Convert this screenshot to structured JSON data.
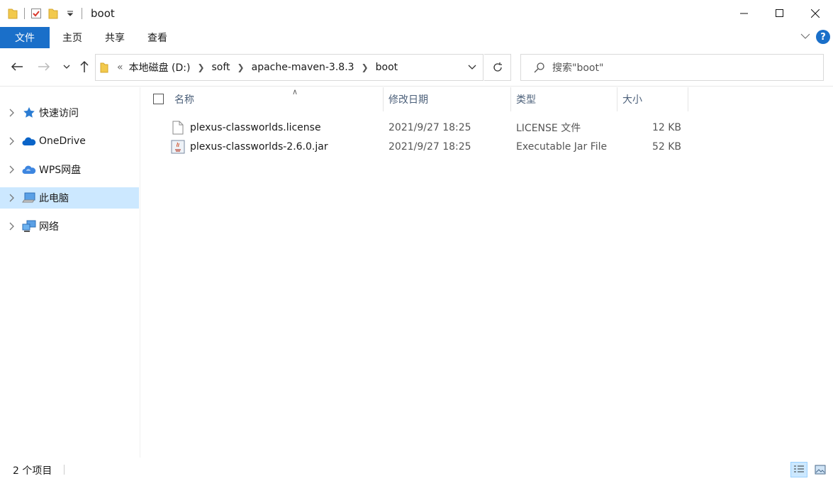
{
  "window": {
    "title": "boot",
    "controls": {
      "minimize": "minimize-icon",
      "maximize": "maximize-icon",
      "close": "close-icon"
    }
  },
  "ribbon": {
    "tabs": [
      {
        "label": "文件",
        "active": true
      },
      {
        "label": "主页"
      },
      {
        "label": "共享"
      },
      {
        "label": "查看"
      }
    ]
  },
  "address": {
    "overflow": "«",
    "crumbs": [
      "本地磁盘 (D:)",
      "soft",
      "apache-maven-3.8.3",
      "boot"
    ]
  },
  "search": {
    "placeholder": "搜索\"boot\""
  },
  "sidebar": {
    "items": [
      {
        "label": "快速访问",
        "icon": "star-icon"
      },
      {
        "label": "OneDrive",
        "icon": "cloud-icon"
      },
      {
        "label": "WPS网盘",
        "icon": "wps-cloud-icon"
      },
      {
        "label": "此电脑",
        "icon": "computer-icon",
        "selected": true
      },
      {
        "label": "网络",
        "icon": "network-icon"
      }
    ]
  },
  "table": {
    "headers": {
      "name": "名称",
      "modified": "修改日期",
      "type": "类型",
      "size": "大小"
    },
    "rows": [
      {
        "name": "plexus-classworlds.license",
        "modified": "2021/9/27 18:25",
        "type": "LICENSE 文件",
        "size": "12 KB",
        "icon": "document-icon"
      },
      {
        "name": "plexus-classworlds-2.6.0.jar",
        "modified": "2021/9/27 18:25",
        "type": "Executable Jar File",
        "size": "52 KB",
        "icon": "jar-icon"
      }
    ]
  },
  "status": {
    "count": "2 个项目"
  },
  "colors": {
    "accent": "#1a6fc9",
    "selection": "#cce8ff",
    "header_text": "#4c607a"
  }
}
